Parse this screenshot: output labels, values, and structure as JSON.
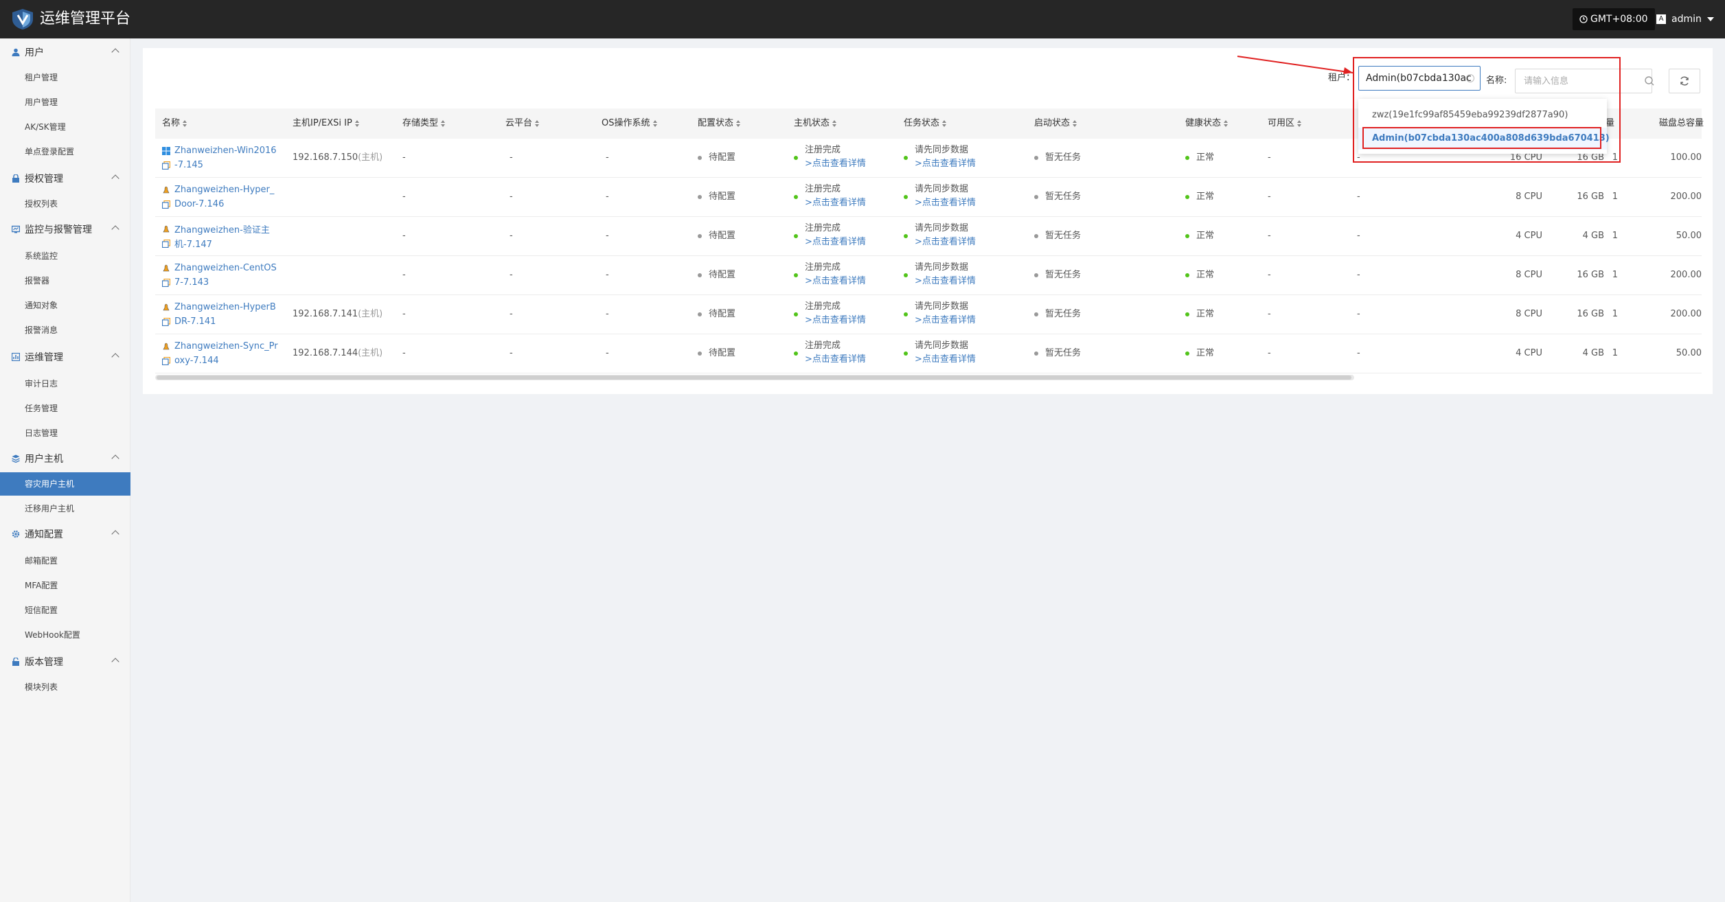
{
  "header": {
    "title": "运维管理平台",
    "timezone": "GMT+08:00",
    "user": "admin",
    "avatar_text": "A"
  },
  "sidebar": {
    "groups": [
      {
        "label": "用户",
        "icon": "user-icon",
        "items": [
          "租户管理",
          "用户管理",
          "AK/SK管理",
          "单点登录配置"
        ]
      },
      {
        "label": "授权管理",
        "icon": "license-icon",
        "items": [
          "授权列表"
        ]
      },
      {
        "label": "监控与报警管理",
        "icon": "monitor-icon",
        "items": [
          "系统监控",
          "报警器",
          "通知对象",
          "报警消息"
        ]
      },
      {
        "label": "运维管理",
        "icon": "ops-icon",
        "items": [
          "审计日志",
          "任务管理",
          "日志管理"
        ]
      },
      {
        "label": "用户主机",
        "icon": "host-icon",
        "items": [
          "容灾用户主机",
          "迁移用户主机"
        ]
      },
      {
        "label": "通知配置",
        "icon": "gear-icon",
        "items": [
          "邮箱配置",
          "MFA配置",
          "短信配置",
          "WebHook配置"
        ]
      },
      {
        "label": "版本管理",
        "icon": "version-icon",
        "items": [
          "模块列表"
        ]
      }
    ],
    "active_item": "容灾用户主机"
  },
  "filters": {
    "tenant_label": "租户：",
    "tenant_value": "Admin(b07cbda130ac",
    "name_label": "名称:",
    "name_placeholder": "请输入信息"
  },
  "dropdown": {
    "options": [
      "zwz(19e1fc99af85459eba99239df2877a90)",
      "Admin(b07cbda130ac400a808d639bda670413)"
    ],
    "selected_index": 1
  },
  "table": {
    "columns": [
      "名称",
      "主机IP/EXSi IP",
      "存储类型",
      "云平台",
      "OS操作系统",
      "配置状态",
      "主机状态",
      "任务状态",
      "启动状态",
      "健康状态",
      "可用区",
      "量",
      "磁盘总容量"
    ],
    "rows": [
      {
        "os": "windows",
        "name1": "Zhanweizhen-Win2016",
        "name2": "-7.145",
        "ip": "192.168.7.150",
        "ip_tag": "(主机)",
        "storage": "-",
        "cloud": "-",
        "os_sys": "-",
        "config": "待配置",
        "host1": "注册完成",
        "host2": ">点击查看详情",
        "task1": "请先同步数据",
        "task2": ">点击查看详情",
        "boot": "暂无任务",
        "health": "正常",
        "zone": "-",
        "zone2": "-",
        "cpu": "16 CPU",
        "mem": "16 GB",
        "count": "1",
        "disk": "100.00"
      },
      {
        "os": "linux",
        "name1": "Zhangweizhen-Hyper_",
        "name2": "Door-7.146",
        "ip": "",
        "ip_tag": "",
        "storage": "-",
        "cloud": "-",
        "os_sys": "-",
        "config": "待配置",
        "host1": "注册完成",
        "host2": ">点击查看详情",
        "task1": "请先同步数据",
        "task2": ">点击查看详情",
        "boot": "暂无任务",
        "health": "正常",
        "zone": "-",
        "zone2": "-",
        "cpu": "8 CPU",
        "mem": "16 GB",
        "count": "1",
        "disk": "200.00"
      },
      {
        "os": "linux",
        "name1": "Zhangweizhen-验证主",
        "name2": "机-7.147",
        "ip": "",
        "ip_tag": "",
        "storage": "-",
        "cloud": "-",
        "os_sys": "-",
        "config": "待配置",
        "host1": "注册完成",
        "host2": ">点击查看详情",
        "task1": "请先同步数据",
        "task2": ">点击查看详情",
        "boot": "暂无任务",
        "health": "正常",
        "zone": "-",
        "zone2": "-",
        "cpu": "4 CPU",
        "mem": "4 GB",
        "count": "1",
        "disk": "50.00"
      },
      {
        "os": "linux",
        "name1": "Zhangweizhen-CentOS",
        "name2": "7-7.143",
        "ip": "",
        "ip_tag": "",
        "storage": "-",
        "cloud": "-",
        "os_sys": "-",
        "config": "待配置",
        "host1": "注册完成",
        "host2": ">点击查看详情",
        "task1": "请先同步数据",
        "task2": ">点击查看详情",
        "boot": "暂无任务",
        "health": "正常",
        "zone": "-",
        "zone2": "-",
        "cpu": "8 CPU",
        "mem": "16 GB",
        "count": "1",
        "disk": "200.00"
      },
      {
        "os": "linux",
        "name1": "Zhangweizhen-HyperB",
        "name2": "DR-7.141",
        "ip": "192.168.7.141",
        "ip_tag": "(主机)",
        "storage": "-",
        "cloud": "-",
        "os_sys": "-",
        "config": "待配置",
        "host1": "注册完成",
        "host2": ">点击查看详情",
        "task1": "请先同步数据",
        "task2": ">点击查看详情",
        "boot": "暂无任务",
        "health": "正常",
        "zone": "-",
        "zone2": "-",
        "cpu": "8 CPU",
        "mem": "16 GB",
        "count": "1",
        "disk": "200.00"
      },
      {
        "os": "linux",
        "name1": "Zhangweizhen-Sync_Pr",
        "name2": "oxy-7.144",
        "ip": "192.168.7.144",
        "ip_tag": "(主机)",
        "storage": "-",
        "cloud": "-",
        "os_sys": "-",
        "config": "待配置",
        "host1": "注册完成",
        "host2": ">点击查看详情",
        "task1": "请先同步数据",
        "task2": ">点击查看详情",
        "boot": "暂无任务",
        "health": "正常",
        "zone": "-",
        "zone2": "-",
        "cpu": "4 CPU",
        "mem": "4 GB",
        "count": "1",
        "disk": "50.00"
      }
    ]
  },
  "colors": {
    "accent": "#3e7bbf",
    "header_bg": "#262626",
    "status_green": "#52c41a",
    "annotation_red": "#e02020"
  }
}
